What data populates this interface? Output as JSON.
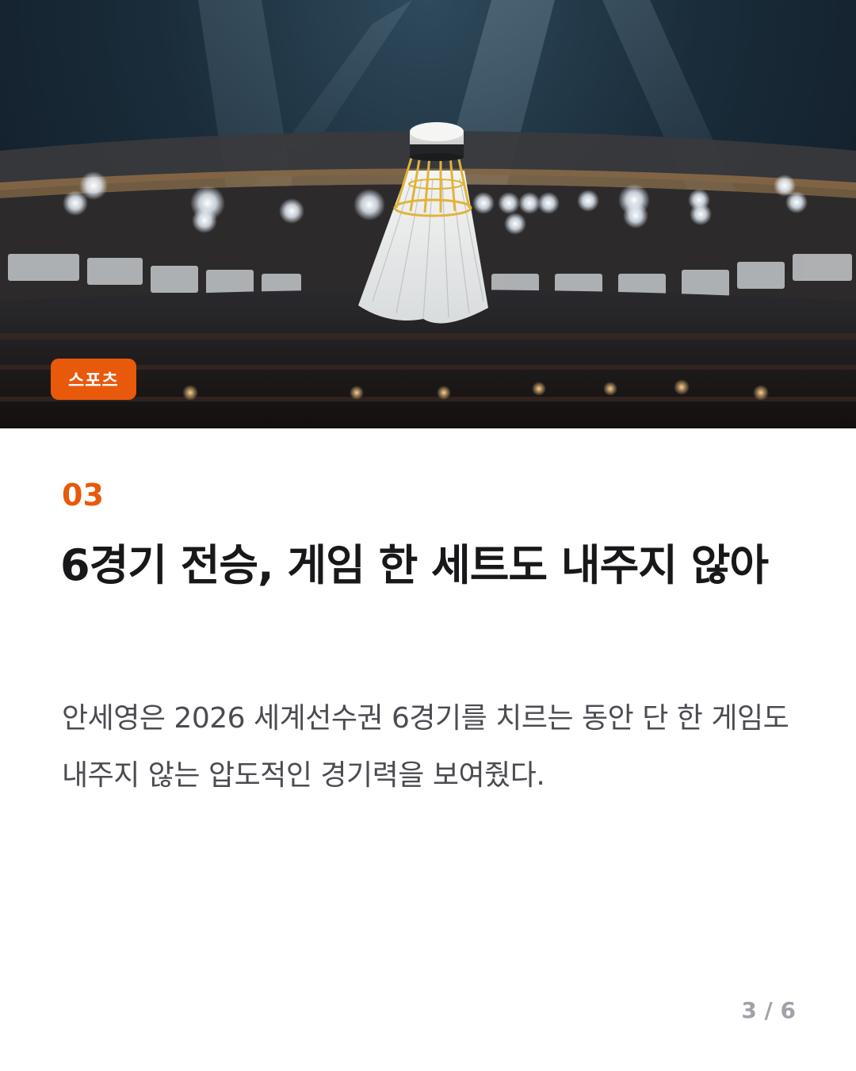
{
  "hero": {
    "image_subject": "badminton-shuttlecock-in-arena",
    "category_badge": "스포츠"
  },
  "article": {
    "number": "03",
    "headline": "6경기 전승, 게임 한 세트도 내주지 않아",
    "body": "안세영은 2026 세계선수권 6경기를 치르는 동안 단 한 게임도 내주지 않는 압도적인 경기력을 보여줬다."
  },
  "pagination": {
    "label": "3 / 6"
  },
  "colors": {
    "accent": "#e8590c",
    "headline": "#18181b",
    "body": "#4b4b52",
    "muted": "#a1a1aa",
    "background": "#ffffff"
  }
}
